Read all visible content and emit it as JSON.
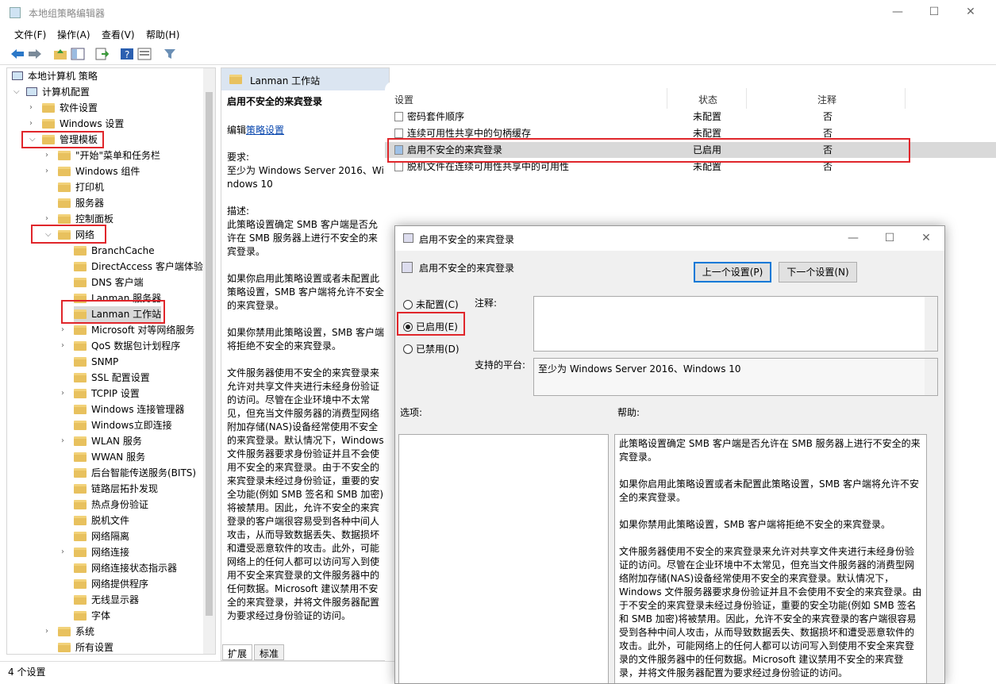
{
  "window": {
    "title": "本地组策略编辑器",
    "minimize": "—",
    "maximize": "☐",
    "close": "✕"
  },
  "menu": [
    "文件(F)",
    "操作(A)",
    "查看(V)",
    "帮助(H)"
  ],
  "tree": {
    "root": "本地计算机 策略",
    "computer_config": "计算机配置",
    "items": [
      {
        "label": "软件设置"
      },
      {
        "label": "Windows 设置"
      },
      {
        "label": "管理模板"
      },
      {
        "label": "\"开始\"菜单和任务栏"
      },
      {
        "label": "Windows 组件"
      },
      {
        "label": "打印机"
      },
      {
        "label": "服务器"
      },
      {
        "label": "控制面板"
      },
      {
        "label": "网络"
      },
      {
        "label": "BranchCache"
      },
      {
        "label": "DirectAccess 客户端体验设置"
      },
      {
        "label": "DNS 客户端"
      },
      {
        "label": "Lanman 服务器"
      },
      {
        "label": "Lanman 工作站"
      },
      {
        "label": "Microsoft 对等网络服务"
      },
      {
        "label": "QoS 数据包计划程序"
      },
      {
        "label": "SNMP"
      },
      {
        "label": "SSL 配置设置"
      },
      {
        "label": "TCPIP 设置"
      },
      {
        "label": "Windows 连接管理器"
      },
      {
        "label": "Windows立即连接"
      },
      {
        "label": "WLAN 服务"
      },
      {
        "label": "WWAN 服务"
      },
      {
        "label": "后台智能传送服务(BITS)"
      },
      {
        "label": "链路层拓扑发现"
      },
      {
        "label": "热点身份验证"
      },
      {
        "label": "脱机文件"
      },
      {
        "label": "网络隔离"
      },
      {
        "label": "网络连接"
      },
      {
        "label": "网络连接状态指示器"
      },
      {
        "label": "网络提供程序"
      },
      {
        "label": "无线显示器"
      },
      {
        "label": "字体"
      },
      {
        "label": "系统"
      },
      {
        "label": "所有设置"
      }
    ]
  },
  "desc": {
    "header": "Lanman 工作站",
    "title": "启用不安全的来宾登录",
    "edit_prefix": "编辑",
    "edit_link": "策略设置",
    "req_label": "要求:",
    "req_text": "至少为 Windows Server 2016、Windows 10",
    "desc_label": "描述:",
    "p1": "此策略设置确定 SMB 客户端是否允许在 SMB 服务器上进行不安全的来宾登录。",
    "p2": "如果你启用此策略设置或者未配置此策略设置，SMB 客户端将允许不安全的来宾登录。",
    "p3": "如果你禁用此策略设置，SMB 客户端将拒绝不安全的来宾登录。",
    "p4": "文件服务器使用不安全的来宾登录来允许对共享文件夹进行未经身份验证的访问。尽管在企业环境中不太常见，但充当文件服务器的消费型网络附加存储(NAS)设备经常使用不安全的来宾登录。默认情况下，Windows 文件服务器要求身份验证并且不会使用不安全的来宾登录。由于不安全的来宾登录未经过身份验证，重要的安全功能(例如 SMB 签名和 SMB 加密)将被禁用。因此，允许不安全的来宾登录的客户端很容易受到各种中间人攻击，从而导致数据丢失、数据损坏和遭受恶意软件的攻击。此外，可能网络上的任何人都可以访问写入到使用不安全来宾登录的文件服务器中的任何数据。Microsoft 建议禁用不安全的来宾登录，并将文件服务器配置为要求经过身份验证的访问。"
  },
  "tabs": [
    "扩展",
    "标准"
  ],
  "list": {
    "headers": {
      "name": "设置",
      "state": "状态",
      "comment": "注释"
    },
    "rows": [
      {
        "name": "密码套件顺序",
        "state": "未配置",
        "comment": "否"
      },
      {
        "name": "连续可用性共享中的句柄缓存",
        "state": "未配置",
        "comment": "否"
      },
      {
        "name": "启用不安全的来宾登录",
        "state": "已启用",
        "comment": "否"
      },
      {
        "name": "脱机文件在连续可用性共享中的可用性",
        "state": "未配置",
        "comment": "否"
      }
    ]
  },
  "status": "4 个设置",
  "dialog": {
    "title": "启用不安全的来宾登录",
    "heading": "启用不安全的来宾登录",
    "prev": "上一个设置(P)",
    "next": "下一个设置(N)",
    "opt_notconfig": "未配置(C)",
    "opt_enabled": "已启用(E)",
    "opt_disabled": "已禁用(D)",
    "comment_label": "注释:",
    "platform_label": "支持的平台:",
    "platform_text": "至少为 Windows Server 2016、Windows 10",
    "options_label": "选项:",
    "help_label": "帮助:",
    "help_p1": "此策略设置确定 SMB 客户端是否允许在 SMB 服务器上进行不安全的来宾登录。",
    "help_p2": "如果你启用此策略设置或者未配置此策略设置，SMB 客户端将允许不安全的来宾登录。",
    "help_p3": "如果你禁用此策略设置，SMB 客户端将拒绝不安全的来宾登录。",
    "help_p4": "文件服务器使用不安全的来宾登录来允许对共享文件夹进行未经身份验证的访问。尽管在企业环境中不太常见，但充当文件服务器的消费型网络附加存储(NAS)设备经常使用不安全的来宾登录。默认情况下，Windows 文件服务器要求身份验证并且不会使用不安全的来宾登录。由于不安全的来宾登录未经过身份验证，重要的安全功能(例如 SMB 签名和 SMB 加密)将被禁用。因此，允许不安全的来宾登录的客户端很容易受到各种中间人攻击，从而导致数据丢失、数据损坏和遭受恶意软件的攻击。此外，可能网络上的任何人都可以访问写入到使用不安全来宾登录的文件服务器中的任何数据。Microsoft 建议禁用不安全的来宾登录，并将文件服务器配置为要求经过身份验证的访问。"
  },
  "colors": {
    "highlight": "#e0262b",
    "accent": "#0078d7",
    "header_bg": "#dbe5f1"
  }
}
